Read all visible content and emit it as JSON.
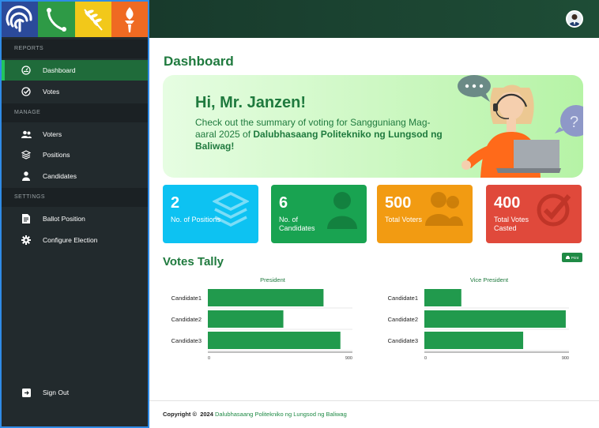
{
  "sidebar": {
    "sections": [
      {
        "label": "REPORTS"
      },
      {
        "label": "MANAGE"
      },
      {
        "label": "SETTINGS"
      }
    ],
    "items": [
      {
        "label": "Dashboard",
        "icon": "dashboard-icon",
        "active": true
      },
      {
        "label": "Votes",
        "icon": "check-circle-icon"
      },
      {
        "label": "Voters",
        "icon": "users-icon"
      },
      {
        "label": "Positions",
        "icon": "layers-icon"
      },
      {
        "label": "Candidates",
        "icon": "user-icon"
      },
      {
        "label": "Ballot Position",
        "icon": "document-icon"
      },
      {
        "label": "Configure Election",
        "icon": "gear-icon"
      },
      {
        "label": "Sign Out",
        "icon": "sign-out-icon"
      }
    ],
    "logo_colors": [
      "#2b4a9a",
      "#2e9a46",
      "#f2c81a",
      "#ef6a22"
    ]
  },
  "main": {
    "title": "Dashboard",
    "hero": {
      "greeting": "Hi, Mr. Janzen!",
      "text_prefix": "Check out the summary of voting for Sangguniang Mag-aaral 2025 of ",
      "text_bold": "Dalubhasaang Politekniko ng Lungsod ng Baliwag!"
    },
    "stats": [
      {
        "value": "2",
        "label": "No. of Positions",
        "color": "#0dc2f2",
        "icon": "layers-icon"
      },
      {
        "value": "6",
        "label": "No. of Candidates",
        "color": "#19a351",
        "icon": "user-icon"
      },
      {
        "value": "500",
        "label": "Total Voters",
        "color": "#f29b12",
        "icon": "users-icon"
      },
      {
        "value": "400",
        "label": "Total Votes Casted",
        "color": "#e0493b",
        "icon": "check-circle-icon"
      }
    ],
    "tally_title": "Votes Tally",
    "print_label": "Print"
  },
  "chart_data": [
    {
      "type": "bar",
      "title": "President",
      "categories": [
        "Candidate1",
        "Candidate2",
        "Candidate3"
      ],
      "values": [
        720,
        470,
        825
      ],
      "xlim": [
        0,
        900
      ],
      "color": "#219a4d"
    },
    {
      "type": "bar",
      "title": "Vice President",
      "categories": [
        "Candidate1",
        "Candidate2",
        "Candidate3"
      ],
      "values": [
        230,
        880,
        615
      ],
      "xlim": [
        0,
        900
      ],
      "color": "#219a4d"
    }
  ],
  "footer": {
    "prefix": "Copyright ©",
    "year": "2024",
    "link": "Dalubhasaang Politekniko ng Lungsod ng Baliwag"
  }
}
